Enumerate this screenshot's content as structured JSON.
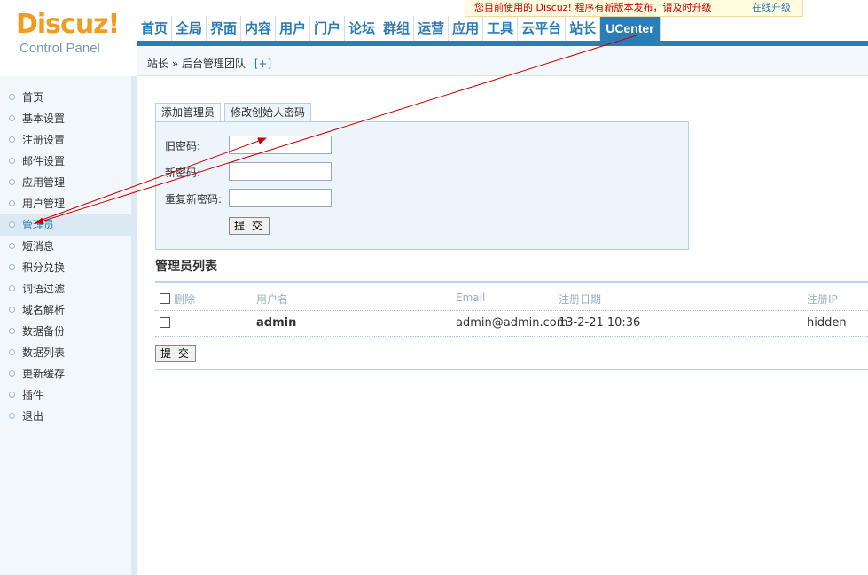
{
  "logo": {
    "title": "Discuz!",
    "subtitle": "Control Panel"
  },
  "notice": {
    "message": "您目前使用的 Discuz! 程序有新版本发布，请及时升级",
    "link": "在线升级"
  },
  "topnav": [
    "首页",
    "全局",
    "界面",
    "内容",
    "用户",
    "门户",
    "论坛",
    "群组",
    "运营",
    "应用",
    "工具",
    "云平台",
    "站长",
    "UCenter"
  ],
  "breadcrumb": {
    "path": "站长 » 后台管理团队",
    "add": "[+]"
  },
  "sidebar": [
    "首页",
    "基本设置",
    "注册设置",
    "邮件设置",
    "应用管理",
    "用户管理",
    "管理员",
    "短消息",
    "积分兑换",
    "词语过滤",
    "域名解析",
    "数据备份",
    "数据列表",
    "更新缓存",
    "插件",
    "退出"
  ],
  "tabs": [
    "添加管理员",
    "修改创始人密码"
  ],
  "form": {
    "old_password": "旧密码:",
    "new_password": "新密码:",
    "repeat_password": "重复新密码:",
    "submit": "提 交"
  },
  "list": {
    "title": "管理员列表",
    "headers": {
      "delete": "删除",
      "username": "用户名",
      "email": "Email",
      "regdate": "注册日期",
      "regip": "注册IP"
    },
    "rows": [
      {
        "username": "admin",
        "email": "admin@admin.com",
        "regdate": "13-2-21 10:36",
        "regip": "hidden"
      }
    ],
    "submit": "提 交"
  },
  "colors": {
    "brand": "#2b7db6",
    "logo": "#f29c1f",
    "arrow": "#cc0000"
  }
}
